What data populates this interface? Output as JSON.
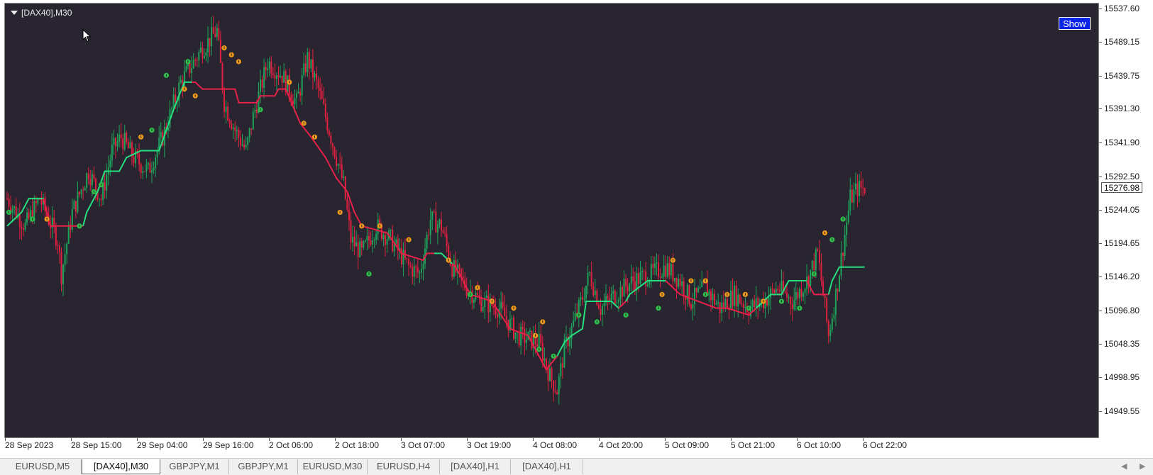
{
  "window": {
    "symbol_title": "[DAX40],M30"
  },
  "toolbar": {
    "show_label": "Show"
  },
  "price_axis": {
    "labels": [
      "15537.60",
      "15489.15",
      "15439.75",
      "15391.30",
      "15341.90",
      "15292.50",
      "15244.05",
      "15194.65",
      "15146.20",
      "15096.80",
      "15048.35",
      "14998.95",
      "14949.55"
    ],
    "current_price": "15276.98"
  },
  "time_axis": {
    "labels": [
      "28 Sep 2023",
      "28 Sep 15:00",
      "29 Sep 04:00",
      "29 Sep 16:00",
      "2 Oct 06:00",
      "2 Oct 18:00",
      "3 Oct 07:00",
      "3 Oct 19:00",
      "4 Oct 08:00",
      "4 Oct 20:00",
      "5 Oct 09:00",
      "5 Oct 21:00",
      "6 Oct 10:00",
      "6 Oct 22:00"
    ]
  },
  "tabs": [
    {
      "label": "EURUSD,M5",
      "active": false
    },
    {
      "label": "[DAX40],M30",
      "active": true
    },
    {
      "label": "GBPJPY,M1",
      "active": false
    },
    {
      "label": "GBPJPY,M1",
      "active": false
    },
    {
      "label": "EURUSD,M30",
      "active": false
    },
    {
      "label": "EURUSD,H4",
      "active": false
    },
    {
      "label": "[DAX40],H1",
      "active": false
    },
    {
      "label": "[DAX40],H1",
      "active": false
    }
  ],
  "colors": {
    "background": "#282530",
    "bull_candle": "#1fa35a",
    "bear_candle": "#e0203f",
    "trail_up": "#26e07f",
    "trail_down": "#e8204a",
    "buy_dot": "#2fc04a",
    "sell_dot": "#f09a1a"
  },
  "chart_data": {
    "type": "candlestick",
    "ylim": [
      14930,
      15550
    ],
    "anchor_prices": [
      [
        0,
        15260
      ],
      [
        10,
        15220
      ],
      [
        18,
        15260
      ],
      [
        28,
        15200
      ],
      [
        30,
        15150
      ],
      [
        36,
        15240
      ],
      [
        45,
        15300
      ],
      [
        52,
        15260
      ],
      [
        58,
        15330
      ],
      [
        63,
        15350
      ],
      [
        70,
        15320
      ],
      [
        78,
        15300
      ],
      [
        86,
        15350
      ],
      [
        96,
        15430
      ],
      [
        108,
        15480
      ],
      [
        116,
        15505
      ],
      [
        120,
        15400
      ],
      [
        126,
        15360
      ],
      [
        132,
        15330
      ],
      [
        136,
        15380
      ],
      [
        144,
        15460
      ],
      [
        152,
        15440
      ],
      [
        160,
        15400
      ],
      [
        166,
        15465
      ],
      [
        172,
        15420
      ],
      [
        180,
        15340
      ],
      [
        186,
        15280
      ],
      [
        190,
        15200
      ],
      [
        196,
        15180
      ],
      [
        204,
        15220
      ],
      [
        212,
        15200
      ],
      [
        222,
        15160
      ],
      [
        228,
        15150
      ],
      [
        234,
        15230
      ],
      [
        240,
        15220
      ],
      [
        246,
        15160
      ],
      [
        254,
        15130
      ],
      [
        262,
        15110
      ],
      [
        272,
        15100
      ],
      [
        282,
        15060
      ],
      [
        294,
        15050
      ],
      [
        300,
        15000
      ],
      [
        304,
        14980
      ],
      [
        308,
        15040
      ],
      [
        316,
        15100
      ],
      [
        322,
        15150
      ],
      [
        328,
        15100
      ],
      [
        336,
        15120
      ],
      [
        346,
        15140
      ],
      [
        356,
        15150
      ],
      [
        364,
        15160
      ],
      [
        372,
        15140
      ],
      [
        378,
        15110
      ],
      [
        386,
        15130
      ],
      [
        394,
        15100
      ],
      [
        402,
        15120
      ],
      [
        410,
        15100
      ],
      [
        418,
        15110
      ],
      [
        426,
        15130
      ],
      [
        434,
        15110
      ],
      [
        442,
        15140
      ],
      [
        448,
        15180
      ],
      [
        454,
        15060
      ],
      [
        458,
        15120
      ],
      [
        466,
        15260
      ],
      [
        470,
        15275
      ]
    ],
    "trail_line": [
      [
        0,
        15220
      ],
      [
        8,
        15240
      ],
      [
        12,
        15260
      ],
      [
        20,
        15260
      ],
      [
        24,
        15220
      ],
      [
        42,
        15220
      ],
      [
        44,
        15240
      ],
      [
        50,
        15270
      ],
      [
        54,
        15300
      ],
      [
        62,
        15300
      ],
      [
        66,
        15320
      ],
      [
        74,
        15330
      ],
      [
        84,
        15330
      ],
      [
        88,
        15360
      ],
      [
        92,
        15390
      ],
      [
        98,
        15430
      ],
      [
        104,
        15430
      ],
      [
        108,
        15420
      ],
      [
        126,
        15420
      ],
      [
        128,
        15400
      ],
      [
        138,
        15400
      ],
      [
        140,
        15410
      ],
      [
        148,
        15410
      ],
      [
        150,
        15420
      ],
      [
        154,
        15420
      ],
      [
        162,
        15370
      ],
      [
        168,
        15350
      ],
      [
        176,
        15320
      ],
      [
        182,
        15290
      ],
      [
        188,
        15270
      ],
      [
        192,
        15240
      ],
      [
        196,
        15220
      ],
      [
        210,
        15210
      ],
      [
        218,
        15180
      ],
      [
        230,
        15170
      ],
      [
        232,
        15180
      ],
      [
        238,
        15180
      ],
      [
        240,
        15180
      ],
      [
        248,
        15160
      ],
      [
        256,
        15120
      ],
      [
        268,
        15110
      ],
      [
        278,
        15070
      ],
      [
        288,
        15060
      ],
      [
        294,
        15030
      ],
      [
        298,
        15010
      ],
      [
        304,
        15030
      ],
      [
        308,
        15050
      ],
      [
        312,
        15060
      ],
      [
        318,
        15070
      ],
      [
        320,
        15110
      ],
      [
        328,
        15110
      ],
      [
        334,
        15110
      ],
      [
        338,
        15100
      ],
      [
        342,
        15110
      ],
      [
        344,
        15120
      ],
      [
        354,
        15140
      ],
      [
        364,
        15140
      ],
      [
        372,
        15120
      ],
      [
        382,
        15110
      ],
      [
        392,
        15100
      ],
      [
        398,
        15100
      ],
      [
        410,
        15090
      ],
      [
        414,
        15100
      ],
      [
        422,
        15120
      ],
      [
        428,
        15120
      ],
      [
        432,
        15140
      ],
      [
        440,
        15140
      ],
      [
        442,
        15140
      ],
      [
        446,
        15120
      ],
      [
        454,
        15120
      ],
      [
        456,
        15140
      ],
      [
        460,
        15160
      ],
      [
        474,
        15160
      ]
    ],
    "trail_segments": [
      {
        "from": 0,
        "to": 20,
        "dir": "up"
      },
      {
        "from": 20,
        "to": 42,
        "dir": "down"
      },
      {
        "from": 42,
        "to": 102,
        "dir": "up"
      },
      {
        "from": 102,
        "to": 236,
        "dir": "down"
      },
      {
        "from": 236,
        "to": 246,
        "dir": "up"
      },
      {
        "from": 246,
        "to": 304,
        "dir": "down"
      },
      {
        "from": 304,
        "to": 338,
        "dir": "up"
      },
      {
        "from": 338,
        "to": 342,
        "dir": "down"
      },
      {
        "from": 342,
        "to": 364,
        "dir": "up"
      },
      {
        "from": 364,
        "to": 414,
        "dir": "down"
      },
      {
        "from": 414,
        "to": 442,
        "dir": "up"
      },
      {
        "from": 442,
        "to": 454,
        "dir": "down"
      },
      {
        "from": 454,
        "to": 474,
        "dir": "up"
      }
    ],
    "buy_signals": [
      [
        1,
        15240
      ],
      [
        14,
        15230
      ],
      [
        40,
        15220
      ],
      [
        48,
        15270
      ],
      [
        52,
        15280
      ],
      [
        80,
        15360
      ],
      [
        88,
        15440
      ],
      [
        100,
        15460
      ],
      [
        140,
        15390
      ],
      [
        200,
        15150
      ],
      [
        256,
        15120
      ],
      [
        294,
        15040
      ],
      [
        302,
        15030
      ],
      [
        316,
        15090
      ],
      [
        326,
        15080
      ],
      [
        342,
        15090
      ],
      [
        360,
        15100
      ],
      [
        386,
        15120
      ],
      [
        410,
        15100
      ],
      [
        428,
        15110
      ],
      [
        438,
        15100
      ],
      [
        446,
        15150
      ],
      [
        456,
        15200
      ],
      [
        462,
        15230
      ]
    ],
    "sell_signals": [
      [
        22,
        15230
      ],
      [
        74,
        15350
      ],
      [
        98,
        15420
      ],
      [
        104,
        15410
      ],
      [
        120,
        15480
      ],
      [
        124,
        15470
      ],
      [
        128,
        15460
      ],
      [
        156,
        15430
      ],
      [
        164,
        15370
      ],
      [
        170,
        15350
      ],
      [
        184,
        15240
      ],
      [
        196,
        15220
      ],
      [
        206,
        15220
      ],
      [
        222,
        15200
      ],
      [
        244,
        15170
      ],
      [
        260,
        15130
      ],
      [
        268,
        15110
      ],
      [
        280,
        15100
      ],
      [
        292,
        15060
      ],
      [
        296,
        15080
      ],
      [
        362,
        15120
      ],
      [
        368,
        15170
      ],
      [
        378,
        15140
      ],
      [
        386,
        15140
      ],
      [
        398,
        15120
      ],
      [
        408,
        15120
      ],
      [
        418,
        15110
      ],
      [
        452,
        15210
      ]
    ]
  }
}
